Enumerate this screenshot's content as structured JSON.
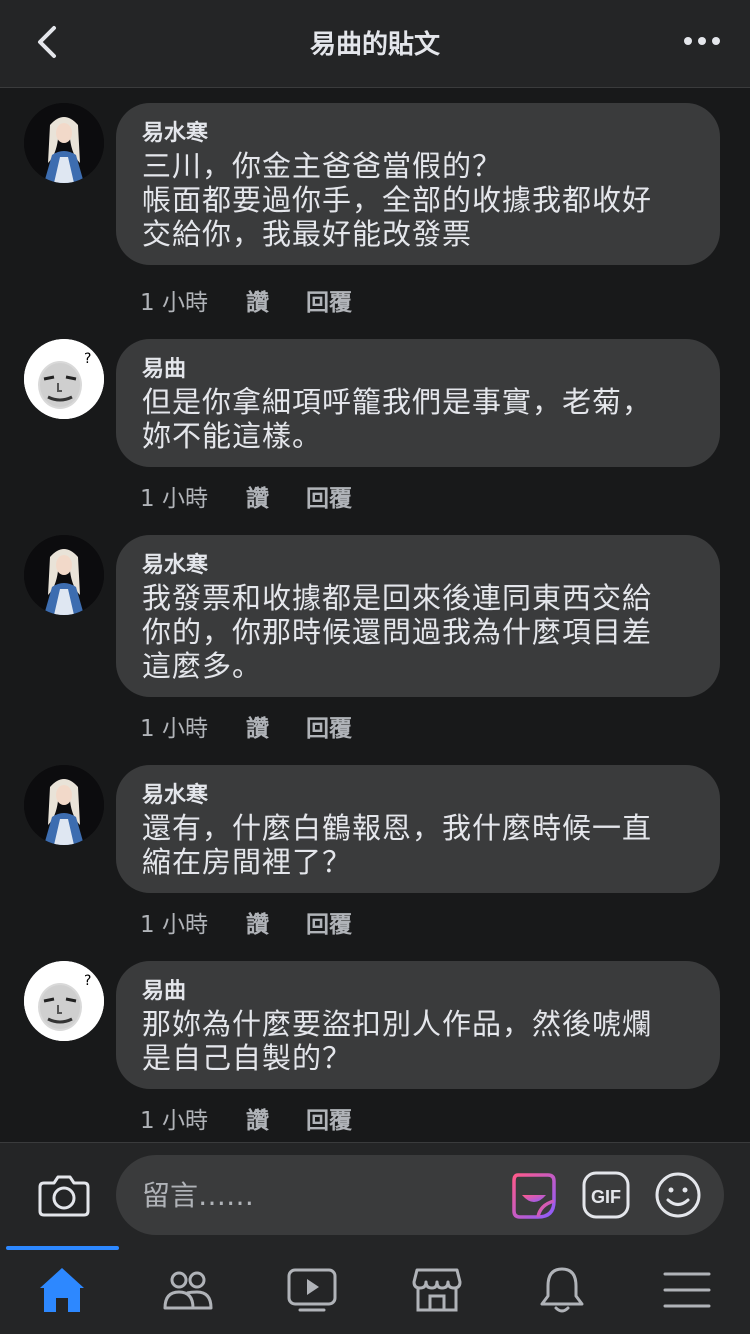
{
  "header": {
    "title": "易曲的貼文",
    "back_icon": "chevron-left-icon",
    "more_icon": "more-horizontal-icon"
  },
  "comments": [
    {
      "author": "易水寒",
      "avatar": "avatar-long-hair-portrait",
      "text": "三川，你金主爸爸當假的？\n帳面都要過你手，全部的收據我都收好\n交給你，我最好能改發票",
      "time": "1 小時",
      "like": "讚",
      "reply": "回覆"
    },
    {
      "author": "易曲",
      "avatar": "avatar-meme-face",
      "text": "但是你拿細項呼籠我們是事實，老菊，\n妳不能這樣。",
      "time": "1 小時",
      "like": "讚",
      "reply": "回覆"
    },
    {
      "author": "易水寒",
      "avatar": "avatar-long-hair-portrait",
      "text": "我發票和收據都是回來後連同東西交給\n你的，你那時候還問過我為什麼項目差\n這麼多。",
      "time": "1 小時",
      "like": "讚",
      "reply": "回覆"
    },
    {
      "author": "易水寒",
      "avatar": "avatar-long-hair-portrait",
      "text": "還有，什麼白鶴報恩，我什麼時候一直\n縮在房間裡了？",
      "time": "1 小時",
      "like": "讚",
      "reply": "回覆"
    },
    {
      "author": "易曲",
      "avatar": "avatar-meme-face",
      "text": "那妳為什麼要盜扣別人作品，然後唬爛\n是自己自製的？",
      "time": "1 小時",
      "like": "讚",
      "reply": "回覆"
    }
  ],
  "composer": {
    "placeholder": "留言……",
    "camera_icon": "camera-icon",
    "sticker_icon": "sticker-icon",
    "gif_label": "GIF",
    "emoji_icon": "emoji-icon"
  },
  "tabbar": {
    "items": [
      {
        "icon": "home-icon",
        "active": true
      },
      {
        "icon": "friends-icon",
        "active": false
      },
      {
        "icon": "watch-icon",
        "active": false
      },
      {
        "icon": "marketplace-icon",
        "active": false
      },
      {
        "icon": "bell-icon",
        "active": false
      },
      {
        "icon": "menu-icon",
        "active": false
      }
    ]
  },
  "colors": {
    "background": "#18191a",
    "surface": "#242526",
    "bubble": "#3a3b3c",
    "text_primary": "#e4e6eb",
    "text_secondary": "#b0b3b8",
    "accent": "#2d88ff"
  }
}
